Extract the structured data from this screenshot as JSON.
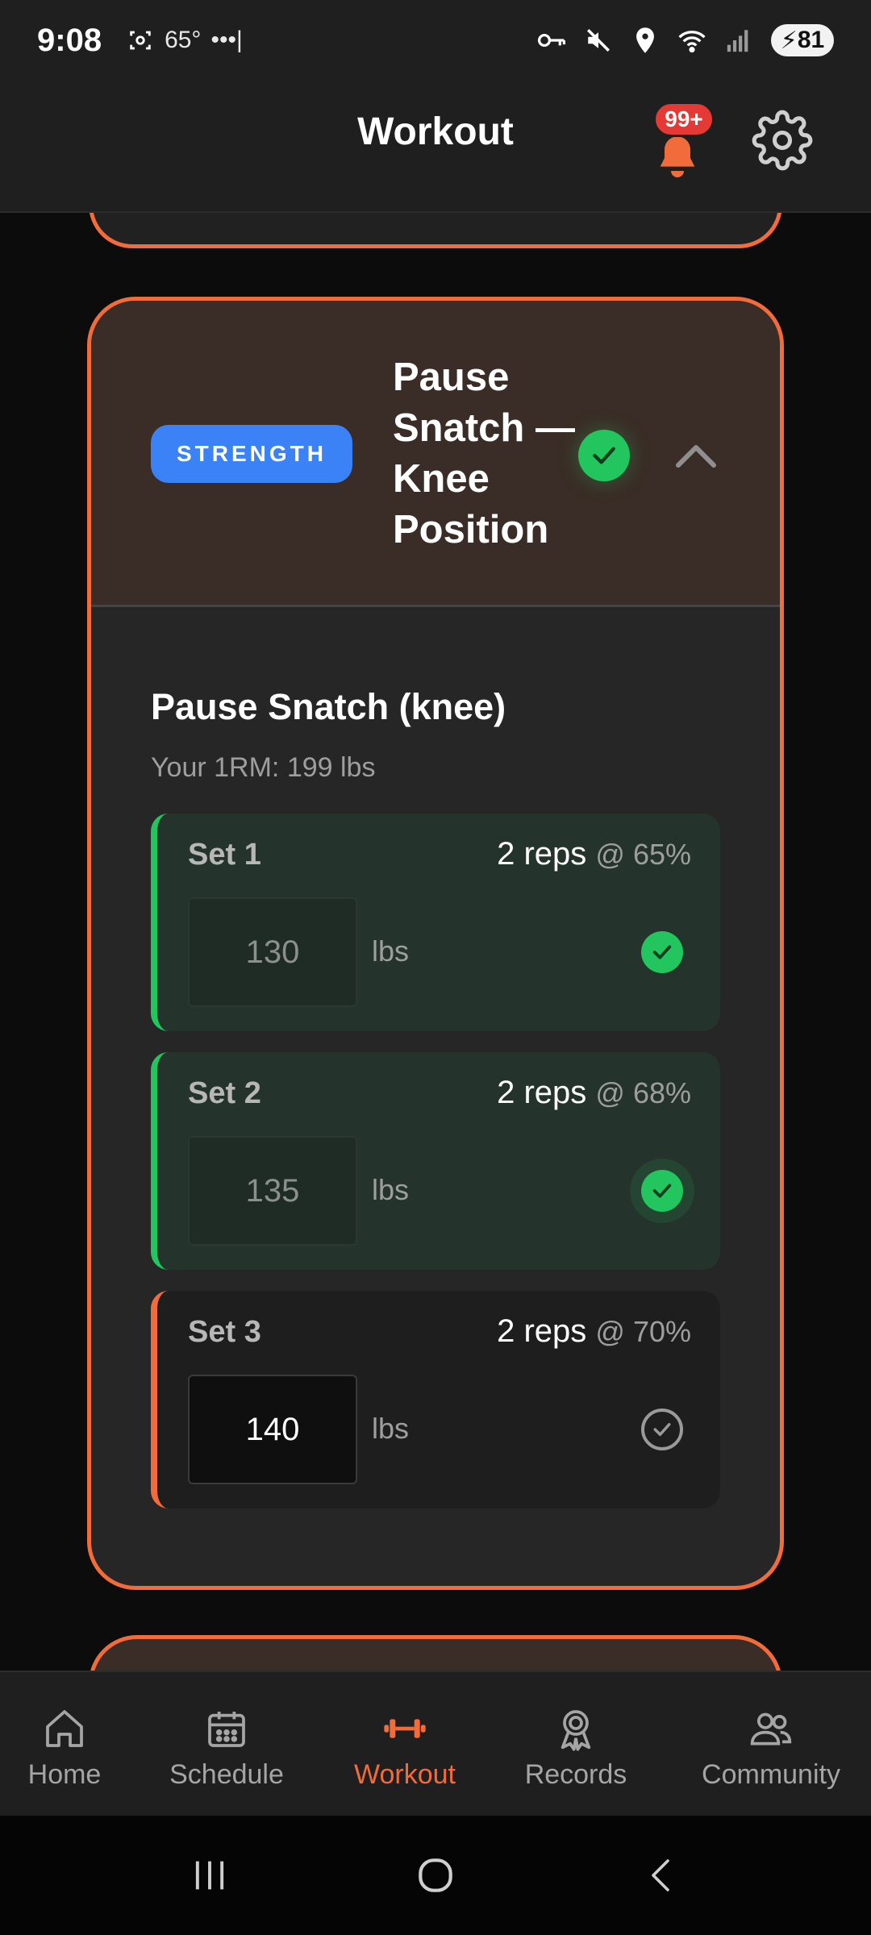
{
  "status_bar": {
    "time": "9:08",
    "weather": "65°",
    "battery": "81"
  },
  "header": {
    "title": "Workout",
    "notification_badge": "99+"
  },
  "exercise": {
    "tag": "STRENGTH",
    "title": "Pause Snatch — Knee Position",
    "lift_name": "Pause Snatch (knee)",
    "one_rm": "Your 1RM: 199 lbs",
    "sets": [
      {
        "label": "Set 1",
        "reps": "2 reps",
        "pct": "@ 65%",
        "weight": "130",
        "unit": "lbs",
        "done": true
      },
      {
        "label": "Set 2",
        "reps": "2 reps",
        "pct": "@ 68%",
        "weight": "135",
        "unit": "lbs",
        "done": true
      },
      {
        "label": "Set 3",
        "reps": "2 reps",
        "pct": "@ 70%",
        "weight": "140",
        "unit": "lbs",
        "done": false
      }
    ]
  },
  "bottom_nav": {
    "items": [
      {
        "label": "Home",
        "icon": "home-icon",
        "active": false
      },
      {
        "label": "Schedule",
        "icon": "calendar-icon",
        "active": false
      },
      {
        "label": "Workout",
        "icon": "dumbbell-icon",
        "active": true
      },
      {
        "label": "Records",
        "icon": "award-icon",
        "active": false
      },
      {
        "label": "Community",
        "icon": "people-icon",
        "active": false
      }
    ]
  },
  "colors": {
    "accent": "#f26b3a",
    "success": "#22c55e",
    "tag_blue": "#3b82f6",
    "badge_red": "#e53935"
  }
}
